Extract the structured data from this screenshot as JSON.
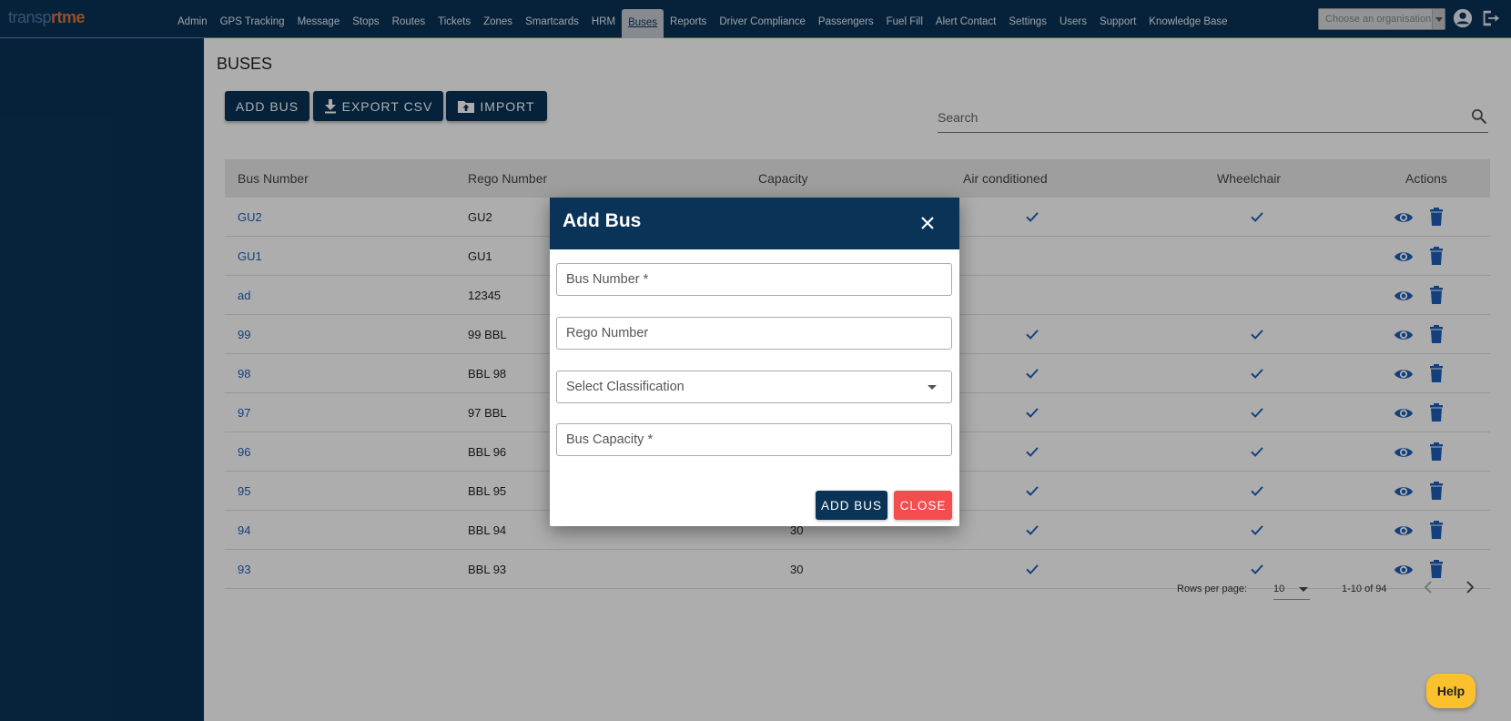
{
  "logo": {
    "part1": "transp",
    "part2": "rt",
    "part3": "me"
  },
  "nav": [
    "Admin",
    "GPS Tracking",
    "Message",
    "Stops",
    "Routes",
    "Tickets",
    "Zones",
    "Smartcards",
    "HRM",
    "Buses",
    "Reports",
    "Driver Compliance",
    "Passengers",
    "Fuel Fill",
    "Alert Contact",
    "Settings",
    "Users",
    "Support",
    "Knowledge Base"
  ],
  "nav_active": "Buses",
  "org_select": {
    "placeholder": "Choose an organisation"
  },
  "page": {
    "title": "BUSES",
    "buttons": {
      "add_bus": "ADD BUS",
      "export_csv": "EXPORT CSV",
      "import": "IMPORT"
    },
    "search": {
      "placeholder": "Search"
    }
  },
  "table": {
    "headers": [
      "Bus Number",
      "Rego Number",
      "Capacity",
      "Air conditioned",
      "Wheelchair",
      "Actions"
    ],
    "rows": [
      {
        "bus": "GU2",
        "rego": "GU2",
        "capacity": "",
        "ac": true,
        "wheelchair": true
      },
      {
        "bus": "GU1",
        "rego": "GU1",
        "capacity": "",
        "ac": false,
        "wheelchair": false
      },
      {
        "bus": "ad",
        "rego": "12345",
        "capacity": "",
        "ac": false,
        "wheelchair": false
      },
      {
        "bus": "99",
        "rego": "99 BBL",
        "capacity": "",
        "ac": true,
        "wheelchair": true
      },
      {
        "bus": "98",
        "rego": "BBL 98",
        "capacity": "",
        "ac": true,
        "wheelchair": true
      },
      {
        "bus": "97",
        "rego": "97 BBL",
        "capacity": "",
        "ac": true,
        "wheelchair": true
      },
      {
        "bus": "96",
        "rego": "BBL 96",
        "capacity": "",
        "ac": true,
        "wheelchair": true
      },
      {
        "bus": "95",
        "rego": "BBL 95",
        "capacity": "",
        "ac": true,
        "wheelchair": true
      },
      {
        "bus": "94",
        "rego": "BBL 94",
        "capacity": "30",
        "ac": true,
        "wheelchair": true
      },
      {
        "bus": "93",
        "rego": "BBL 93",
        "capacity": "30",
        "ac": true,
        "wheelchair": true
      }
    ]
  },
  "pagination": {
    "rows_per_page_label": "Rows per page:",
    "rows_per_page": "10",
    "range": "1-10 of 94"
  },
  "modal": {
    "title": "Add Bus",
    "fields": {
      "bus_number": "Bus Number *",
      "rego_number": "Rego Number",
      "classification": "Select Classification",
      "capacity": "Bus Capacity *"
    },
    "add_button": "ADD BUS",
    "close_button": "CLOSE"
  },
  "help": "Help",
  "colors": {
    "navy": "#0a3358",
    "link": "#1c5fb8",
    "close_red": "#f44d4d",
    "help_yellow": "#fbc02d"
  }
}
